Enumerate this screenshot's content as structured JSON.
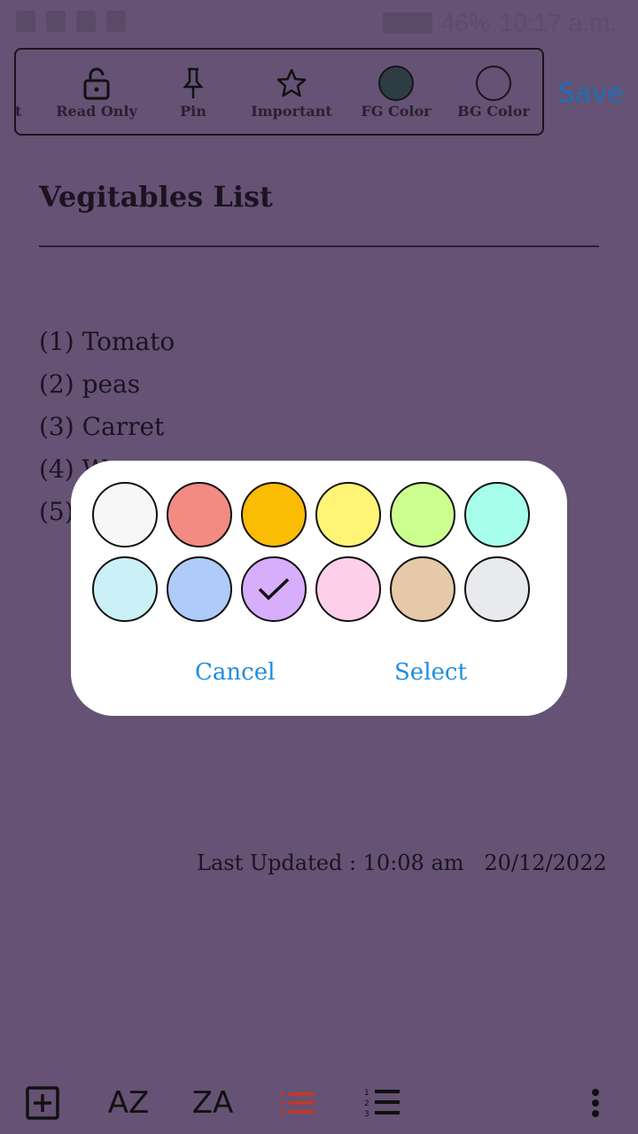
{
  "status_bar": {
    "battery": "46%",
    "time": "10:17 a.m."
  },
  "toolbar": {
    "partial_label": "st",
    "items": [
      {
        "label": "Read Only",
        "icon": "lock-open-icon"
      },
      {
        "label": "Pin",
        "icon": "pin-icon"
      },
      {
        "label": "Important",
        "icon": "star-icon"
      },
      {
        "label": "FG Color",
        "icon": "fg-color-swatch",
        "color": "#2e3d42"
      },
      {
        "label": "BG Color",
        "icon": "bg-color-swatch",
        "color": "#655274"
      }
    ],
    "save_label": "Save"
  },
  "note": {
    "title": "Vegitables List",
    "items": [
      "(1) Tomato",
      "(2) peas",
      "(3) Carret",
      "(4) W",
      "(5)"
    ],
    "last_updated_label": "Last Updated : 10:08 am",
    "last_updated_date": "20/12/2022"
  },
  "color_dialog": {
    "colors": [
      "#f7f7f7",
      "#f28b82",
      "#fbbc04",
      "#fff475",
      "#ccff90",
      "#a7ffeb",
      "#cbf0f8",
      "#aecbfa",
      "#d7aefb",
      "#fdcfe8",
      "#e6c9a8",
      "#e8eaed"
    ],
    "selected_index": 8,
    "cancel_label": "Cancel",
    "select_label": "Select"
  },
  "bottom_bar": {
    "add_icon": "add-box-icon",
    "sort_az_label": "AZ",
    "sort_za_label": "ZA",
    "list_icon": "bulleted-list-icon",
    "numbered_icon": "numbered-list-icon",
    "more_icon": "more-vert-icon",
    "accent": "#c0392b"
  }
}
